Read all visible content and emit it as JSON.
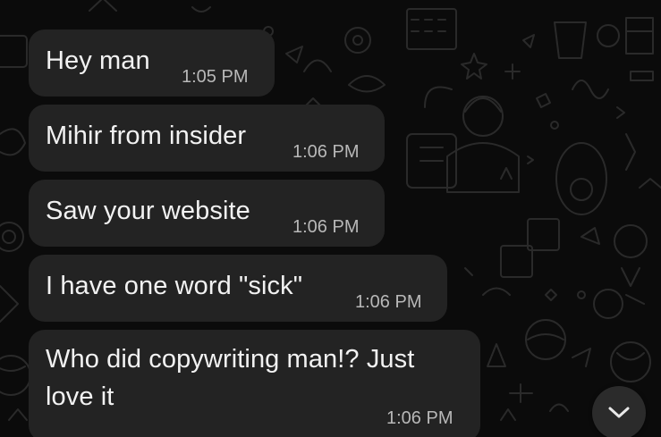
{
  "colors": {
    "background": "#0b0b0b",
    "bubble": "#232323",
    "text": "#f2f2f2",
    "timestamp": "#b8b8b8",
    "doodle": "#2a2a2a"
  },
  "messages": [
    {
      "text": "Hey man",
      "time": "1:05 PM"
    },
    {
      "text": "Mihir from insider",
      "time": "1:06 PM"
    },
    {
      "text": "Saw your website",
      "time": "1:06 PM"
    },
    {
      "text": "I have one word \"sick\"",
      "time": "1:06 PM"
    },
    {
      "text": "Who did copywriting man!? Just love it",
      "time": "1:06 PM"
    }
  ],
  "scroll_button": {
    "icon": "chevron-down-icon"
  }
}
